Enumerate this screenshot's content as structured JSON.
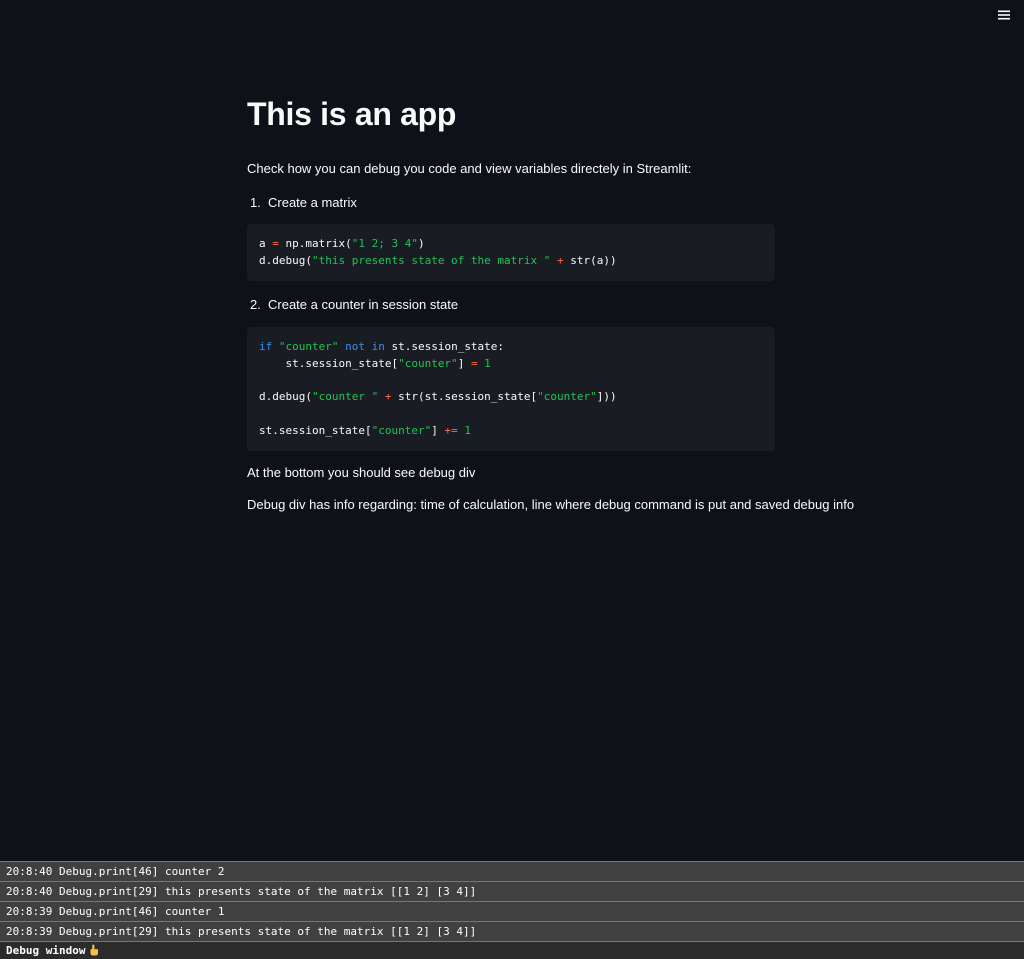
{
  "header": {
    "menu_icon": "hamburger-menu-icon"
  },
  "main": {
    "title": "This is an app",
    "intro": "Check how you can debug you code and view variables directely in Streamlit:",
    "steps": [
      {
        "number": "1.",
        "label": "Create a matrix"
      },
      {
        "number": "2.",
        "label": "Create a counter in session state"
      }
    ],
    "code1": {
      "line1": {
        "a": "a ",
        "eq": "=",
        "b": " np.matrix(",
        "s": "\"1 2; 3 4\"",
        "c": ")"
      },
      "line2": {
        "a": "d.debug(",
        "s": "\"this presents state of the matrix \"",
        "sp": " ",
        "op": "+",
        "b": " str(a))"
      }
    },
    "code2": {
      "line1": {
        "kw1": "if",
        "s": " \"counter\"",
        "kw2": " not in",
        "b": " st.session_state:"
      },
      "line2": {
        "a": "    st.session_state[",
        "s": "\"counter\"",
        "b": "] ",
        "eq": "=",
        "n": " 1"
      },
      "line3": {
        "a": "d.debug(",
        "s": "\"counter \"",
        "sp": " ",
        "op": "+",
        "b": " str(st.session_state[",
        "s2": "\"counter\"",
        "c": "]))"
      },
      "line4": {
        "a": "st.session_state[",
        "s": "\"counter\"",
        "b": "] ",
        "op": "+=",
        "n": " 1"
      }
    },
    "note1": "At the bottom you should see debug div",
    "note2": "Debug div has info regarding: time of calculation, line where debug command is put and saved debug info"
  },
  "debug_window": {
    "rows": [
      "20:8:40 Debug.print[46] counter 2",
      "20:8:40 Debug.print[29] this presents state of the matrix [[1 2] [3 4]]",
      "20:8:39 Debug.print[46] counter 1",
      "20:8:39 Debug.print[29] this presents state of the matrix [[1 2] [3 4]]"
    ],
    "footer_label": "Debug window",
    "footer_icon": "pointing-hand-icon"
  }
}
